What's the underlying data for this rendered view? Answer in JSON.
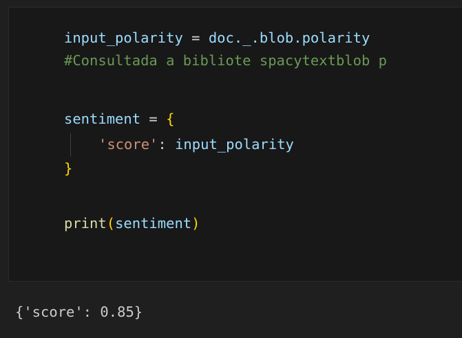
{
  "code_cell": {
    "line1": {
      "var": "input_polarity",
      "op": " = ",
      "expr": "doc._.blob.polarity"
    },
    "line2": {
      "comment": "#Consultada a bibliote spacytextblob p"
    },
    "line4": {
      "var": "sentiment",
      "op": " = ",
      "brace_open": "{"
    },
    "line5": {
      "key": "'score'",
      "colon": ": ",
      "value": "input_polarity"
    },
    "line6": {
      "brace_close": "}"
    },
    "line8": {
      "fn": "print",
      "paren_open": "(",
      "arg": "sentiment",
      "paren_close": ")"
    }
  },
  "output": {
    "text": "{'score': 0.85}"
  },
  "colors": {
    "background": "#1f1f1f",
    "editor_background": "#181818",
    "variable": "#9cdcfe",
    "comment": "#6a9955",
    "string": "#ce9178",
    "function": "#dcdcaa",
    "brace": "#ffd700"
  }
}
